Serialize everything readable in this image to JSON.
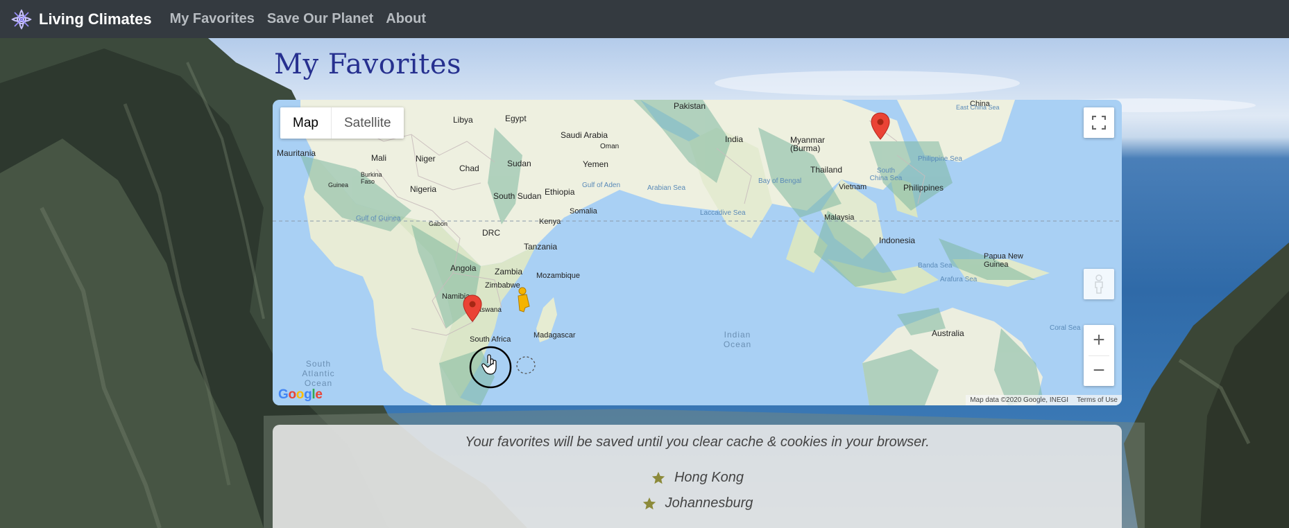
{
  "navbar": {
    "brand": "Living Climates",
    "links": [
      "My Favorites",
      "Save Our Planet",
      "About"
    ]
  },
  "page": {
    "title": "My Favorites"
  },
  "map": {
    "type_controls": {
      "map": "Map",
      "satellite": "Satellite"
    },
    "zoom_in": "+",
    "zoom_out": "−",
    "google_logo": "Google",
    "attribution": "Map data ©2020 Google, INEGI",
    "terms": "Terms of Use",
    "country_labels": {
      "pakistan": "Pakistan",
      "egypt": "Egypt",
      "libya": "Libya",
      "saudi_arabia": "Saudi Arabia",
      "oman": "Oman",
      "yemen": "Yemen",
      "mauritania": "Mauritania",
      "mali": "Mali",
      "niger": "Niger",
      "chad": "Chad",
      "sudan": "Sudan",
      "burkina_faso": "Burkina Faso",
      "guinea": "Guinea",
      "nigeria": "Nigeria",
      "ethiopia": "Ethiopia",
      "south_sudan": "South Sudan",
      "somalia": "Somalia",
      "gabon": "Gabon",
      "kenya": "Kenya",
      "drc": "DRC",
      "tanzania": "Tanzania",
      "angola": "Angola",
      "zambia": "Zambia",
      "mozambique": "Mozambique",
      "zimbabwe": "Zimbabwe",
      "namibia": "Namibia",
      "botswana": "Botswana",
      "madagascar": "Madagascar",
      "south_africa": "South Africa",
      "india": "India",
      "myanmar": "Myanmar (Burma)",
      "thailand": "Thailand",
      "vietnam": "Vietnam",
      "philippines": "Philippines",
      "malaysia": "Malaysia",
      "indonesia": "Indonesia",
      "papua_new_guinea": "Papua New Guinea",
      "australia": "Australia",
      "china": "China"
    },
    "water_labels": {
      "gulf_of_aden": "Gulf of Aden",
      "arabian_sea": "Arabian Sea",
      "bay_of_bengal": "Bay of Bengal",
      "laccadive_sea": "Laccadive Sea",
      "south_china_sea": "South China Sea",
      "philippine_sea": "Philippine Sea",
      "east_china_sea": "East China Sea",
      "gulf_of_guinea": "Gulf of Guinea",
      "banda_sea": "Banda Sea",
      "arafura_sea": "Arafura Sea",
      "coral_sea": "Coral Sea",
      "indian_ocean": "Indian Ocean",
      "south_atlantic_ocean": "South Atlantic Ocean"
    },
    "markers": [
      {
        "name": "Hong Kong",
        "color": "#ea4335"
      },
      {
        "name": "Johannesburg",
        "color": "#ea4335"
      }
    ]
  },
  "favorites": {
    "note": "Your favorites will be saved until you clear cache & cookies in your browser.",
    "items": [
      "Hong Kong",
      "Johannesburg"
    ],
    "star_color": "#8c8a3a"
  },
  "icons": {
    "brand": "leaf-globe-icon",
    "fullscreen": "fullscreen-icon",
    "pegman": "pegman-icon",
    "star": "star-icon",
    "marker": "map-pin-icon"
  }
}
